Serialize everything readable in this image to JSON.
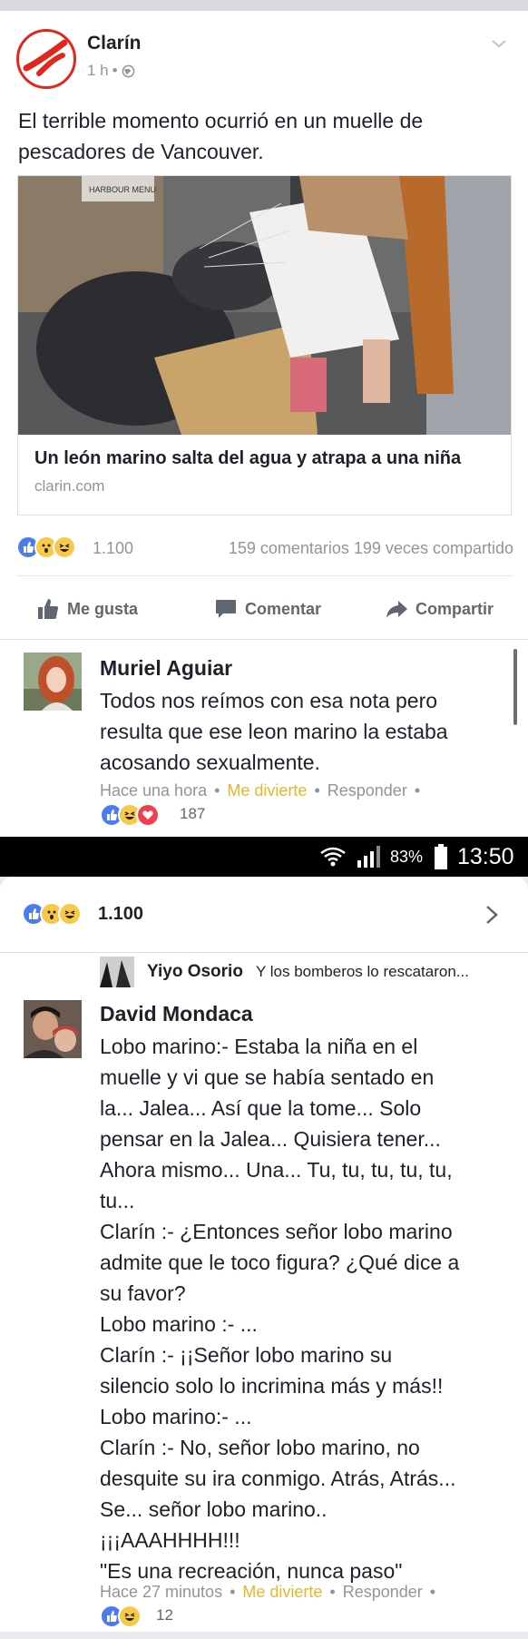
{
  "post": {
    "page_name": "Clarín",
    "time": "1 h",
    "dot": "•",
    "text": "El terrible momento ocurrió en un muelle de pescadores de Vancouver.",
    "link": {
      "image_sign_text": "HARBOUR MENU",
      "title": "Un león marino salta del agua y atrapa a una niña",
      "domain": "clarin.com"
    },
    "reactions": {
      "icons": [
        "like-icon",
        "wow-icon",
        "haha-icon"
      ],
      "count": "1.100"
    },
    "stats": "159 comentarios 199 veces compartido",
    "actions": {
      "like": "Me gusta",
      "comment": "Comentar",
      "share": "Compartir"
    },
    "colors": {
      "brand_red": "#e1261c",
      "meta_gray": "#90949c",
      "action_gray": "#606770",
      "me_divierte": "#e4b72b"
    }
  },
  "comment1": {
    "author": "Muriel Aguiar",
    "text_lines": [
      "Todos nos reímos con esa nota pero",
      "resulta que ese leon marino la estaba",
      "acosando sexualmente."
    ],
    "meta": {
      "time": "Hace una hora",
      "reaction": "Me divierte",
      "reply": "Responder",
      "dot": "•"
    },
    "reactions": {
      "icons": [
        "like-icon",
        "haha-icon",
        "love-icon"
      ],
      "count": "187"
    }
  },
  "status_bar": {
    "battery_pct": "83%",
    "time": "13:50"
  },
  "sheet": {
    "reactions": {
      "icons": [
        "like-icon",
        "wow-icon",
        "haha-icon"
      ],
      "count": "1.100"
    },
    "reply": {
      "author": "Yiyo Osorio",
      "text": "Y los bomberos lo rescataron..."
    },
    "comment2": {
      "author": "David Mondaca",
      "text_lines": [
        "Lobo marino:- Estaba la niña en el",
        "muelle y vi que se había sentado en",
        "la... Jalea... Así que la tome... Solo",
        "pensar en la Jalea... Quisiera tener...",
        "Ahora mismo... Una... Tu, tu, tu, tu, tu,",
        "tu...",
        "Clarín :- ¿Entonces señor lobo marino",
        "admite que le toco figura? ¿Qué dice a",
        "su favor?",
        "Lobo marino :- ...",
        "Clarín :- ¡¡Señor lobo marino su",
        "silencio solo lo incrimina más y más!!",
        "Lobo marino:- ...",
        "Clarín :- No, señor lobo marino, no",
        "desquite su ira conmigo. Atrás, Atrás...",
        "Se... señor lobo marino..",
        "¡¡¡AAAHHHH!!!",
        "\"Es una recreación, nunca paso\""
      ],
      "meta": {
        "time": "Hace 27 minutos",
        "reaction": "Me divierte",
        "reply": "Responder",
        "dot": "•"
      },
      "reactions": {
        "icons": [
          "like-icon",
          "haha-icon"
        ],
        "count": "12"
      }
    }
  }
}
